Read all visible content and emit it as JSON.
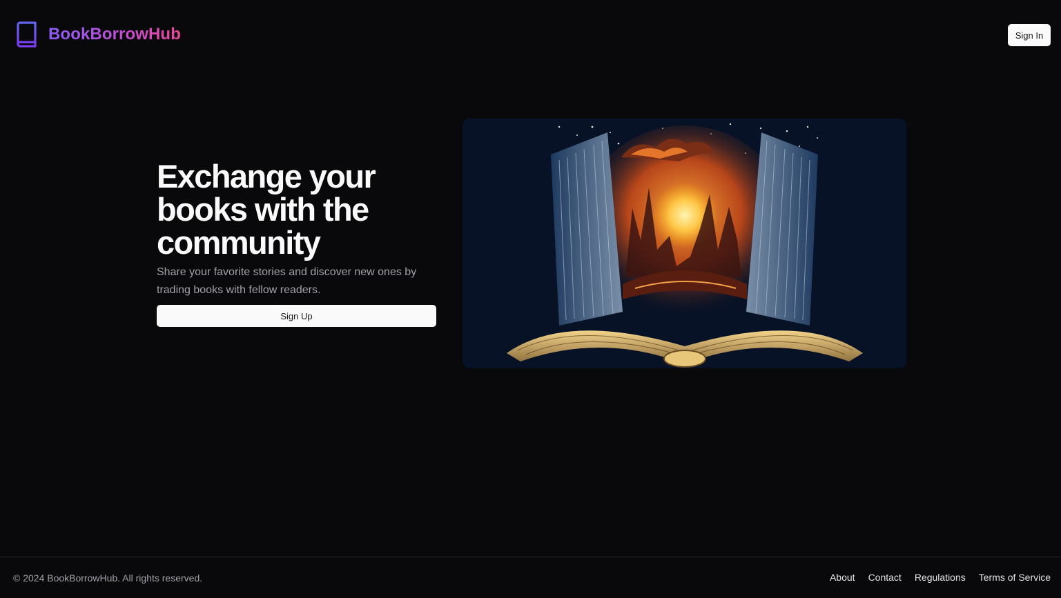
{
  "header": {
    "brand_name": "BookBorrowHub",
    "brand_icon": "book-icon",
    "signin_label": "Sign In"
  },
  "hero": {
    "headline": "Exchange your books with the community",
    "subtext": "Share your favorite stories and discover new ones by trading books with fellow readers.",
    "signup_label": "Sign Up",
    "image": "open-book-sunset-illustration"
  },
  "footer": {
    "copyright": "© 2024 BookBorrowHub. All rights reserved.",
    "links": [
      {
        "label": "About"
      },
      {
        "label": "Contact"
      },
      {
        "label": "Regulations"
      },
      {
        "label": "Terms of Service"
      }
    ]
  },
  "colors": {
    "background": "#09090b",
    "brand_gradient_start": "#8b5cf6",
    "brand_gradient_end": "#ec4899",
    "button_bg": "#fafafa",
    "muted_text": "#a1a1aa"
  }
}
